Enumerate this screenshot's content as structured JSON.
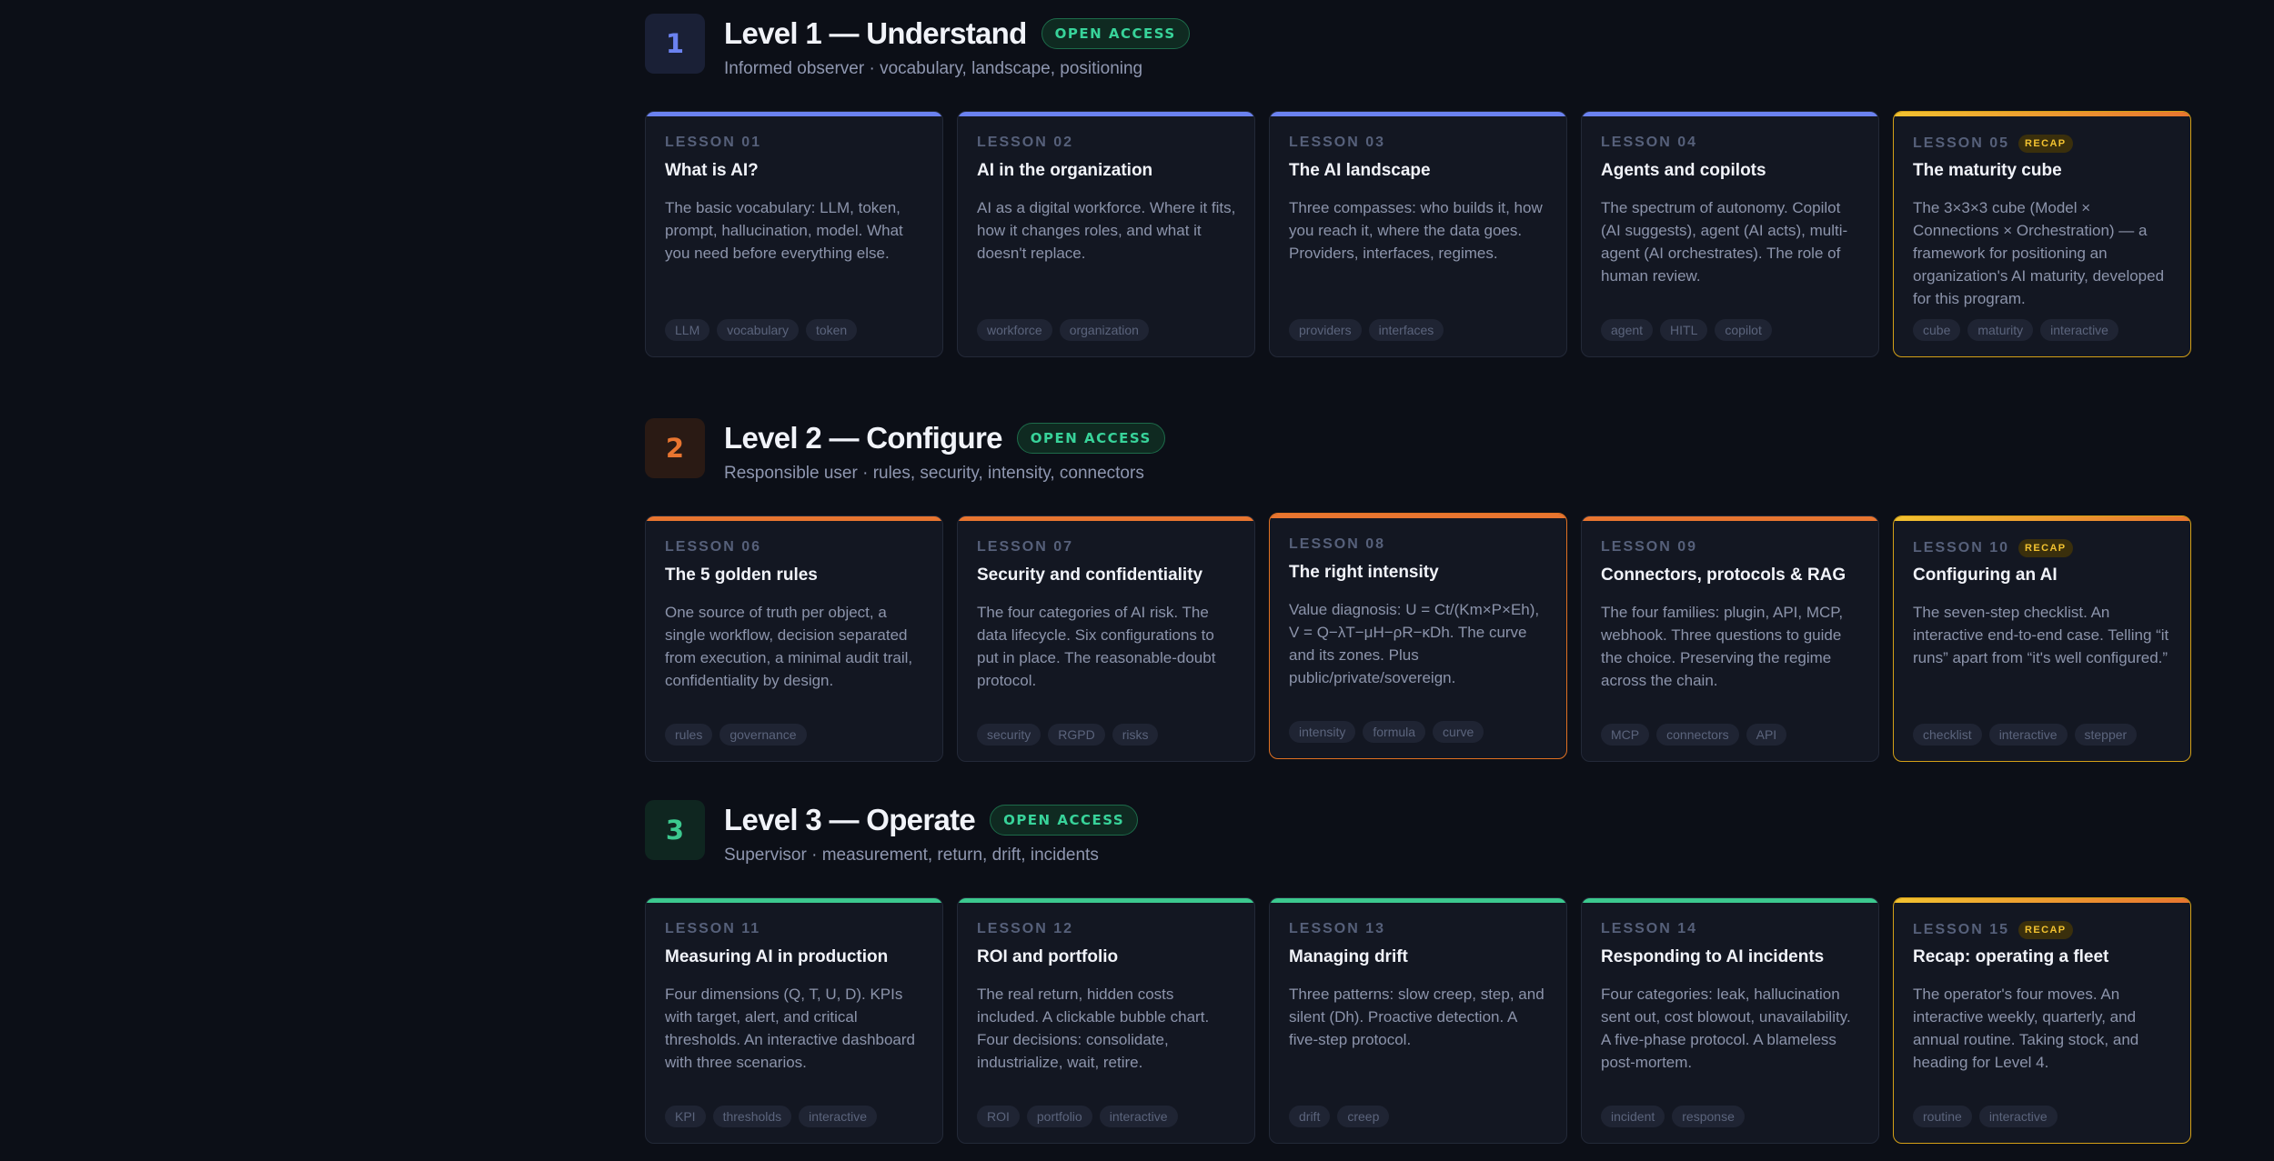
{
  "colors": {
    "level1": "#6b82f0",
    "level2": "#e87530",
    "level3": "#3cc98f",
    "recap": "#e8a81c"
  },
  "levels": [
    {
      "number": "1",
      "title": "Level 1 — Understand",
      "badge": "OPEN ACCESS",
      "subtitle": "Informed observer · vocabulary, landscape, positioning",
      "lessons": [
        {
          "label": "LESSON 01",
          "title": "What is AI?",
          "description": "The basic vocabulary: LLM, token, prompt, hallucination, model. What you need before everything else.",
          "tags": [
            "LLM",
            "vocabulary",
            "token"
          ]
        },
        {
          "label": "LESSON 02",
          "title": "AI in the organization",
          "description": "AI as a digital workforce. Where it fits, how it changes roles, and what it doesn't replace.",
          "tags": [
            "workforce",
            "organization"
          ]
        },
        {
          "label": "LESSON 03",
          "title": "The AI landscape",
          "description": "Three compasses: who builds it, how you reach it, where the data goes. Providers, interfaces, regimes.",
          "tags": [
            "providers",
            "interfaces"
          ]
        },
        {
          "label": "LESSON 04",
          "title": "Agents and copilots",
          "description": "The spectrum of autonomy. Copilot (AI suggests), agent (AI acts), multi-agent (AI orchestrates). The role of human review.",
          "tags": [
            "agent",
            "HITL",
            "copilot"
          ]
        },
        {
          "label": "LESSON 05",
          "recap": "RECAP",
          "title": "The maturity cube",
          "description": "The 3×3×3 cube (Model × Connections × Orchestration) — a framework for positioning an organization's AI maturity, developed for this program.",
          "tags": [
            "cube",
            "maturity",
            "interactive"
          ]
        }
      ]
    },
    {
      "number": "2",
      "title": "Level 2 — Configure",
      "badge": "OPEN ACCESS",
      "subtitle": "Responsible user · rules, security, intensity, connectors",
      "lessons": [
        {
          "label": "LESSON 06",
          "title": "The 5 golden rules",
          "description": "One source of truth per object, a single workflow, decision separated from execution, a minimal audit trail, confidentiality by design.",
          "tags": [
            "rules",
            "governance"
          ]
        },
        {
          "label": "LESSON 07",
          "title": "Security and confidentiality",
          "description": "The four categories of AI risk. The data lifecycle. Six configurations to put in place. The reasonable-doubt protocol.",
          "tags": [
            "security",
            "RGPD",
            "risks"
          ]
        },
        {
          "label": "LESSON 08",
          "title": "The right intensity",
          "description": "Value diagnosis: U = Ct/(Km×P×Eh), V = Q−λT−μH−ρR−κDh. The curve and its zones. Plus public/private/sovereign.",
          "tags": [
            "intensity",
            "formula",
            "curve"
          ]
        },
        {
          "label": "LESSON 09",
          "title": "Connectors, protocols & RAG",
          "description": "The four families: plugin, API, MCP, webhook. Three questions to guide the choice. Preserving the regime across the chain.",
          "tags": [
            "MCP",
            "connectors",
            "API"
          ]
        },
        {
          "label": "LESSON 10",
          "recap": "RECAP",
          "title": "Configuring an AI",
          "description": "The seven-step checklist. An interactive end-to-end case. Telling “it runs” apart from “it's well configured.”",
          "tags": [
            "checklist",
            "interactive",
            "stepper"
          ]
        }
      ]
    },
    {
      "number": "3",
      "title": "Level 3 — Operate",
      "badge": "OPEN ACCESS",
      "subtitle": "Supervisor · measurement, return, drift, incidents",
      "lessons": [
        {
          "label": "LESSON 11",
          "title": "Measuring AI in production",
          "description": "Four dimensions (Q, T, U, D). KPIs with target, alert, and critical thresholds. An interactive dashboard with three scenarios.",
          "tags": [
            "KPI",
            "thresholds",
            "interactive"
          ]
        },
        {
          "label": "LESSON 12",
          "title": "ROI and portfolio",
          "description": "The real return, hidden costs included. A clickable bubble chart. Four decisions: consolidate, industrialize, wait, retire.",
          "tags": [
            "ROI",
            "portfolio",
            "interactive"
          ]
        },
        {
          "label": "LESSON 13",
          "title": "Managing drift",
          "description": "Three patterns: slow creep, step, and silent (Dh). Proactive detection. A five-step protocol.",
          "tags": [
            "drift",
            "creep"
          ]
        },
        {
          "label": "LESSON 14",
          "title": "Responding to AI incidents",
          "description": "Four categories: leak, hallucination sent out, cost blowout, unavailability. A five-phase protocol. A blameless post-mortem.",
          "tags": [
            "incident",
            "response"
          ]
        },
        {
          "label": "LESSON 15",
          "recap": "RECAP",
          "title": "Recap: operating a fleet",
          "description": "The operator's four moves. An interactive weekly, quarterly, and annual routine. Taking stock, and heading for Level 4.",
          "tags": [
            "routine",
            "interactive"
          ]
        }
      ]
    }
  ]
}
